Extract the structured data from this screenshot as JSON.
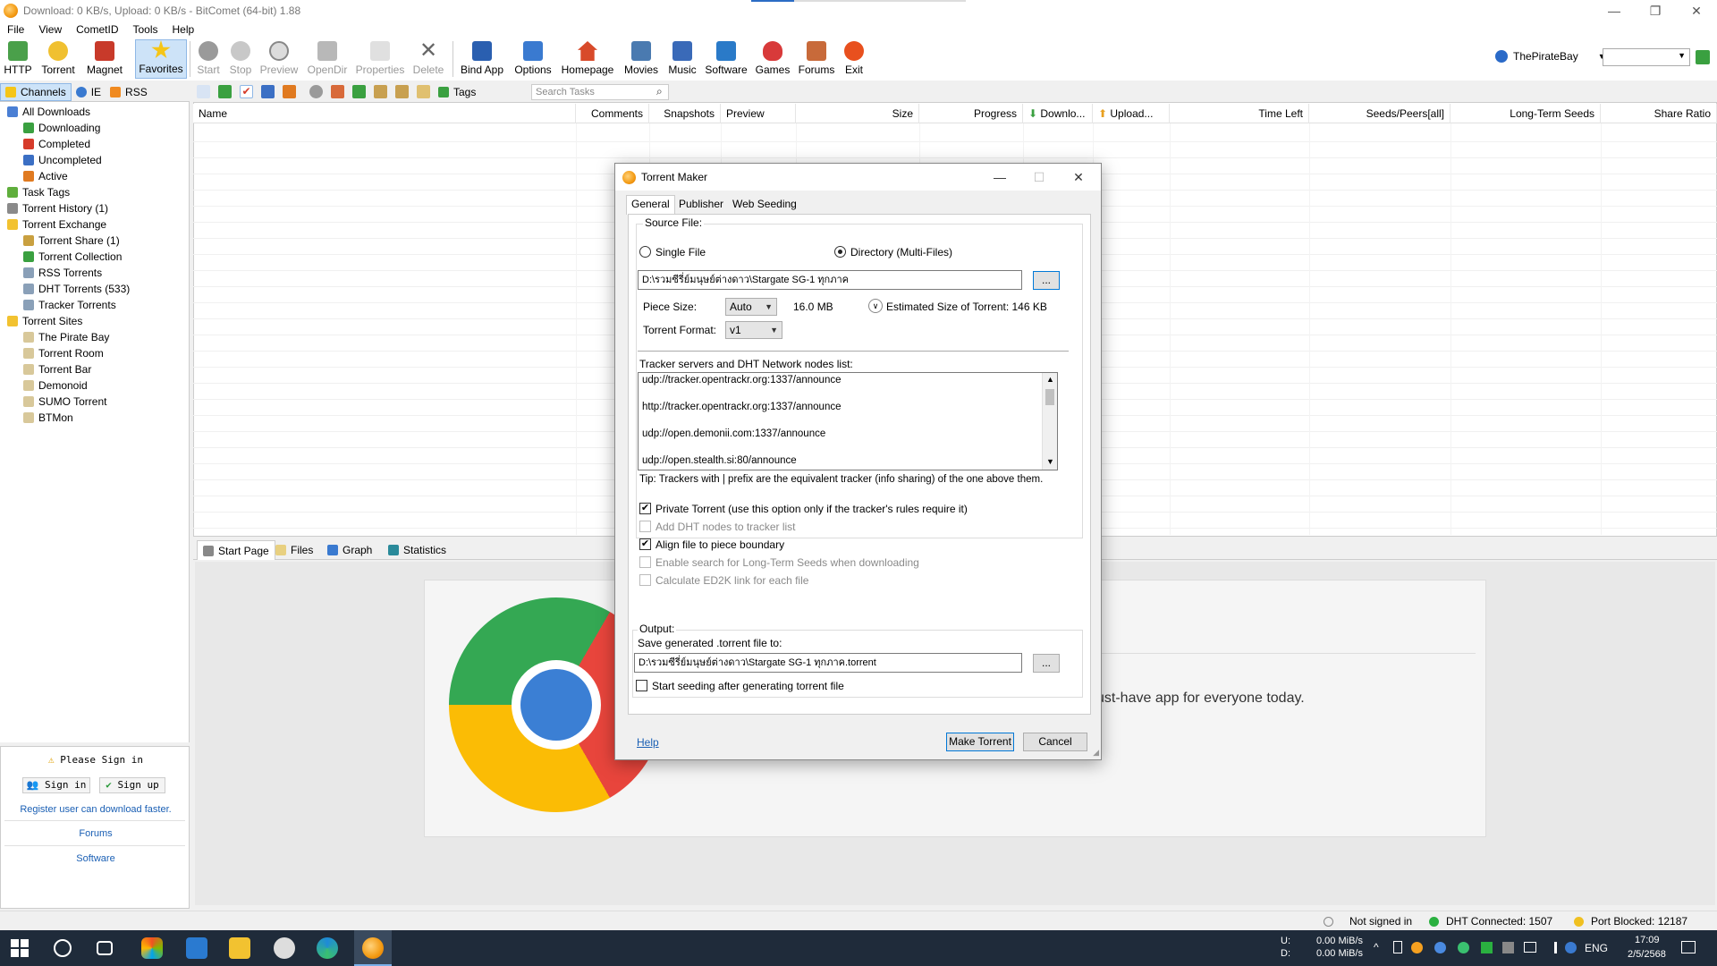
{
  "window": {
    "title": "Download: 0 KB/s, Upload: 0 KB/s - BitComet (64-bit) 1.88",
    "controls": [
      "—",
      "❐",
      "✕"
    ]
  },
  "menu": [
    "File",
    "View",
    "CometID",
    "Tools",
    "Help"
  ],
  "toolbar": {
    "buttons": [
      "HTTP",
      "Torrent",
      "Magnet",
      "Favorites",
      "Start",
      "Stop",
      "Preview",
      "OpenDir",
      "Properties",
      "Delete",
      "Bind App",
      "Options",
      "Homepage",
      "Movies",
      "Music",
      "Software",
      "Games",
      "Forums",
      "Exit"
    ],
    "site_label": "ThePirateBay"
  },
  "left_tabs": [
    "Channels",
    "IE",
    "RSS"
  ],
  "tree": [
    {
      "label": "All Downloads",
      "indent": 0,
      "color": "#4a7fd4"
    },
    {
      "label": "Downloading",
      "indent": 1,
      "color": "#3aa040"
    },
    {
      "label": "Completed",
      "indent": 1,
      "color": "#d63b2a"
    },
    {
      "label": "Uncompleted",
      "indent": 1,
      "color": "#3b6fc4"
    },
    {
      "label": "Active",
      "indent": 1,
      "color": "#e07a20"
    },
    {
      "label": "Task Tags",
      "indent": 0,
      "color": "#5fae3c"
    },
    {
      "label": "Torrent History (1)",
      "indent": 0,
      "color": "#8a8a8a"
    },
    {
      "label": "Torrent Exchange",
      "indent": 0,
      "color": "#f2c230"
    },
    {
      "label": "Torrent Share (1)",
      "indent": 1,
      "color": "#c9a040"
    },
    {
      "label": "Torrent Collection",
      "indent": 1,
      "color": "#3aa040"
    },
    {
      "label": "RSS Torrents",
      "indent": 1,
      "color": "#8aa0b8"
    },
    {
      "label": "DHT Torrents (533)",
      "indent": 1,
      "color": "#8aa0b8"
    },
    {
      "label": "Tracker Torrents",
      "indent": 1,
      "color": "#8aa0b8"
    },
    {
      "label": "Torrent Sites",
      "indent": 0,
      "color": "#f2c230"
    },
    {
      "label": "The Pirate Bay",
      "indent": 1,
      "color": "#d8c89a"
    },
    {
      "label": "Torrent Room",
      "indent": 1,
      "color": "#d8c89a"
    },
    {
      "label": "Torrent Bar",
      "indent": 1,
      "color": "#d8c89a"
    },
    {
      "label": "Demonoid",
      "indent": 1,
      "color": "#d8c89a"
    },
    {
      "label": "SUMO Torrent",
      "indent": 1,
      "color": "#d8c89a"
    },
    {
      "label": "BTMon",
      "indent": 1,
      "color": "#d8c89a"
    }
  ],
  "sign": {
    "warning": "Please Sign in",
    "sign_in": "Sign in",
    "sign_up": "Sign up",
    "register_text": "Register user can download faster.",
    "forums": "Forums",
    "software": "Software"
  },
  "task_toolbar": {
    "tags_label": "Tags",
    "search_placeholder": "Search Tasks"
  },
  "columns": [
    "Name",
    "Comments",
    "Snapshots",
    "Preview",
    "Size",
    "Progress",
    "Downlo...",
    "Upload...",
    "Time Left",
    "Seeds/Peers[all]",
    "Long-Term Seeds",
    "Share Ratio"
  ],
  "bottom_tabs": [
    "Start Page",
    "Files",
    "Graph",
    "Statistics"
  ],
  "promo_text": "ust-have app for everyone today.",
  "status": {
    "signed": "Not signed in",
    "dht": "DHT Connected: 1507",
    "port": "Port Blocked: 12187"
  },
  "taskbar": {
    "net_up_label": "U:",
    "net_down_label": "D:",
    "net_up": "0.00 MiB/s",
    "net_down": "0.00 MiB/s",
    "lang": "ENG",
    "time": "17:09",
    "date": "2/5/2568"
  },
  "dialog": {
    "title": "Torrent Maker",
    "tabs": [
      "General",
      "Publisher",
      "Web Seeding"
    ],
    "source_label": "Source File:",
    "single_file": "Single File",
    "directory": "Directory (Multi-Files)",
    "source_path": "D:\\รวมซีรี่ย์มนุษย์ต่างดาว\\Stargate SG-1 ทุกภาค",
    "browse": "...",
    "piece_size_label": "Piece Size:",
    "piece_size_value": "Auto",
    "piece_size_mb": "16.0 MB",
    "estimated": "Estimated Size of Torrent: 146 KB",
    "format_label": "Torrent Format:",
    "format_value": "v1",
    "tracker_label": "Tracker servers and DHT Network nodes list:",
    "trackers": [
      "udp://tracker.opentrackr.org:1337/announce",
      "http://tracker.opentrackr.org:1337/announce",
      "udp://open.demonii.com:1337/announce",
      "udp://open.stealth.si:80/announce"
    ],
    "tip": "Tip: Trackers with | prefix are the equivalent tracker (info sharing) of the one above them.",
    "options": [
      {
        "label": "Private Torrent (use this option only if the tracker's rules require it)",
        "checked": true,
        "enabled": true
      },
      {
        "label": "Add DHT nodes to tracker list",
        "checked": false,
        "enabled": false
      },
      {
        "label": "Align file to piece boundary",
        "checked": true,
        "enabled": true
      },
      {
        "label": "Enable search for Long-Term Seeds when downloading",
        "checked": false,
        "enabled": false
      },
      {
        "label": "Calculate ED2K link for each file",
        "checked": false,
        "enabled": false
      }
    ],
    "output_label": "Output:",
    "save_label": "Save generated .torrent file to:",
    "output_path": "D:\\รวมซีรี่ย์มนุษย์ต่างดาว\\Stargate SG-1 ทุกภาค.torrent",
    "start_seeding": "Start seeding after generating torrent file",
    "help": "Help",
    "make": "Make Torrent",
    "cancel": "Cancel"
  }
}
